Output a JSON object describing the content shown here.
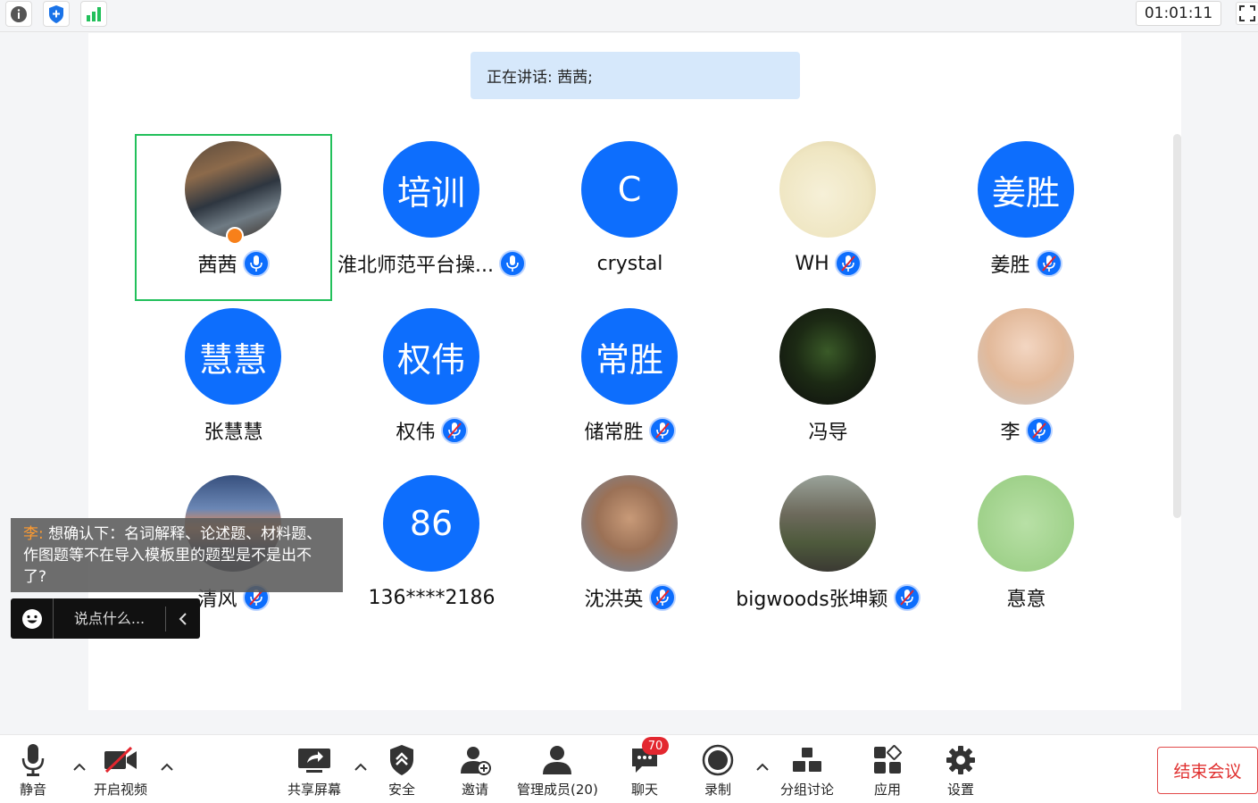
{
  "topbar": {
    "info_icon": "info-icon",
    "security_icon": "shield-plus-icon",
    "signal_icon": "signal-bars-icon",
    "timer": "01:01:11",
    "fullscreen_icon": "fullscreen-icon"
  },
  "speaking": {
    "text": "正在讲话: 茜茜;"
  },
  "participants": [
    {
      "name": "茜茜",
      "avatar_text": "",
      "photo": "street",
      "mic": "on",
      "active": true,
      "host": true
    },
    {
      "name": "淮北师范平台操...",
      "avatar_text": "培训",
      "mic": "on"
    },
    {
      "name": "crystal",
      "avatar_text": "C",
      "mic": "none"
    },
    {
      "name": "WH",
      "avatar_text": "",
      "photo": "cartoon",
      "mic": "muted"
    },
    {
      "name": "姜胜",
      "avatar_text": "姜胜",
      "mic": "muted"
    },
    {
      "name": "张慧慧",
      "avatar_text": "慧慧",
      "mic": "none"
    },
    {
      "name": "权伟",
      "avatar_text": "权伟",
      "mic": "muted"
    },
    {
      "name": "储常胜",
      "avatar_text": "常胜",
      "mic": "muted"
    },
    {
      "name": "冯导",
      "avatar_text": "",
      "photo": "plant",
      "mic": "none"
    },
    {
      "name": "李",
      "avatar_text": "",
      "photo": "sunglasses",
      "mic": "muted"
    },
    {
      "name": "清风",
      "avatar_text": "",
      "photo": "sunset",
      "mic": "muted"
    },
    {
      "name": "136****2186",
      "avatar_text": "86",
      "mic": "none"
    },
    {
      "name": "沈洪英",
      "avatar_text": "",
      "photo": "man",
      "mic": "muted"
    },
    {
      "name": "bigwoods张坤颖",
      "avatar_text": "",
      "photo": "path",
      "mic": "muted"
    },
    {
      "name": "惪意",
      "avatar_text": "",
      "photo": "calligraphy",
      "mic": "none"
    }
  ],
  "chat": {
    "sender": "李:",
    "message": " 想确认下：名词解释、论述题、材料题、作图题等不在导入模板里的题型是不是出不了?",
    "input_placeholder": "说点什么..."
  },
  "toolbar": {
    "mute": "静音",
    "video": "开启视频",
    "share": "共享屏幕",
    "security": "安全",
    "invite": "邀请",
    "members": "管理成员(20)",
    "chat": "聊天",
    "chat_badge": "70",
    "record": "录制",
    "breakout": "分组讨论",
    "apps": "应用",
    "settings": "设置",
    "end": "结束会议"
  },
  "colors": {
    "accent": "#0d6efd",
    "active_border": "#22c05b",
    "end": "#e0302f",
    "speaking_bg": "#d6e8fb"
  }
}
